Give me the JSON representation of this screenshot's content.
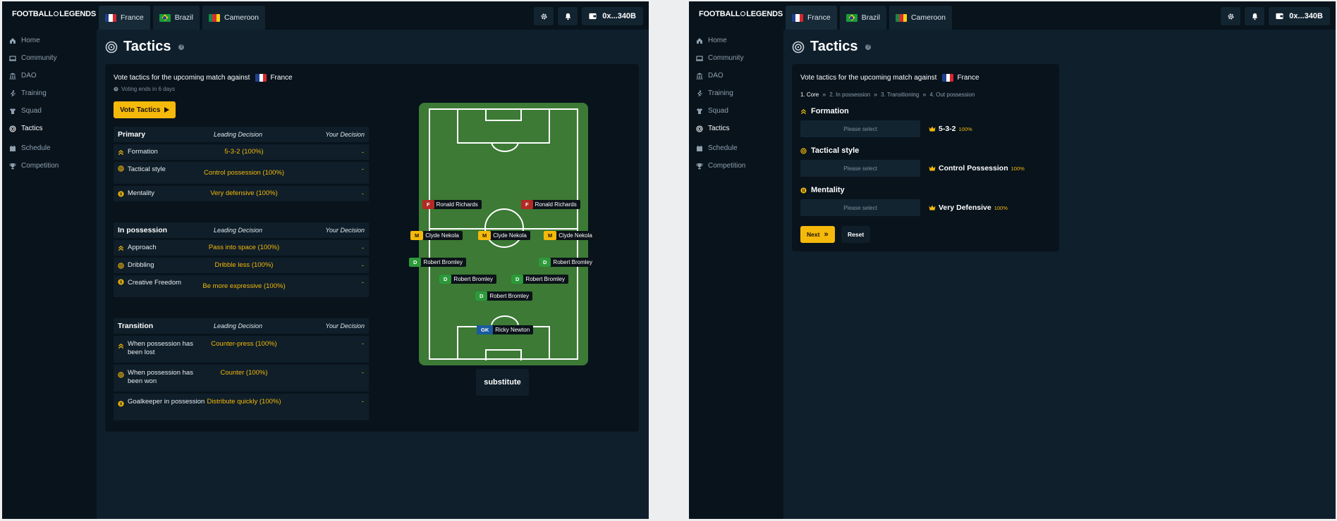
{
  "app": {
    "logo_left": "FOOTBALL",
    "logo_right": "LEGENDS",
    "wallet": "0x...340B"
  },
  "tabs": [
    {
      "label": "France",
      "flag": "france"
    },
    {
      "label": "Brazil",
      "flag": "brazil"
    },
    {
      "label": "Cameroon",
      "flag": "cameroon"
    }
  ],
  "sidebar": {
    "items": [
      {
        "label": "Home",
        "icon": "home-icon"
      },
      {
        "label": "Community",
        "icon": "monitor-icon"
      },
      {
        "label": "DAO",
        "icon": "bank-icon"
      },
      {
        "label": "Training",
        "icon": "run-icon"
      },
      {
        "label": "Squad",
        "icon": "shirt-icon"
      },
      {
        "label": "Tactics",
        "icon": "target-icon",
        "active": true
      },
      {
        "label": "Schedule",
        "icon": "calendar-icon"
      },
      {
        "label": "Competition",
        "icon": "trophy-icon"
      }
    ]
  },
  "page": {
    "title": "Tactics",
    "help": "?"
  },
  "vote": {
    "text": "Vote tactics for the upcoming match against",
    "opponent": "France",
    "ends": "Voting ends in 6 days",
    "button": "Vote Tactics"
  },
  "table_headers": {
    "leading": "Leading Decision",
    "yours": "Your Decision"
  },
  "sections": [
    {
      "title": "Primary",
      "rows": [
        {
          "label": "Formation",
          "lead": "5-3-2 (100%)",
          "yours": "-"
        },
        {
          "label": "Tactical style",
          "lead": "Control possession (100%)",
          "yours": "-"
        },
        {
          "label": "Mentality",
          "lead": "Very defensive (100%)",
          "yours": "-"
        }
      ]
    },
    {
      "title": "In possession",
      "rows": [
        {
          "label": "Approach",
          "lead": "Pass into space (100%)",
          "yours": "-"
        },
        {
          "label": "Dribbling",
          "lead": "Dribble less (100%)",
          "yours": "-"
        },
        {
          "label": "Creative Freedom",
          "lead": "Be more expressive (100%)",
          "yours": "-"
        }
      ]
    },
    {
      "title": "Transition",
      "rows": [
        {
          "label": "When possession has been lost",
          "lead": "Counter-press (100%)",
          "yours": "-"
        },
        {
          "label": "When possession has been won",
          "lead": "Counter (100%)",
          "yours": "-"
        },
        {
          "label": "Goalkeeper in possession",
          "lead": "Distribute quickly (100%)",
          "yours": "-"
        }
      ]
    }
  ],
  "players": [
    {
      "pos": "F",
      "name": "Ronald Richards"
    },
    {
      "pos": "F",
      "name": "Ronald Richards"
    },
    {
      "pos": "M",
      "name": "Clyde Nekola"
    },
    {
      "pos": "M",
      "name": "Clyde Nekola"
    },
    {
      "pos": "M",
      "name": "Clyde Nekola"
    },
    {
      "pos": "D",
      "name": "Robert Bromley"
    },
    {
      "pos": "D",
      "name": "Robert Bromley"
    },
    {
      "pos": "D",
      "name": "Robert Bromley"
    },
    {
      "pos": "D",
      "name": "Robert Bromley"
    },
    {
      "pos": "D",
      "name": "Robert Bromley"
    },
    {
      "pos": "GK",
      "name": "Ricky Newton"
    }
  ],
  "substitute": "substitute",
  "wizard": {
    "steps": [
      "1. Core",
      "2. In possession",
      "3. Transitioning",
      "4. Out possession"
    ],
    "fields": [
      {
        "title": "Formation",
        "placeholder": "Please select",
        "leading": "5-3-2",
        "pct": "100%"
      },
      {
        "title": "Tactical style",
        "placeholder": "Please select",
        "leading": "Control Possession",
        "pct": "100%"
      },
      {
        "title": "Mentality",
        "placeholder": "Please select",
        "leading": "Very Defensive",
        "pct": "100%"
      }
    ],
    "next": "Next",
    "reset": "Reset"
  },
  "colors": {
    "accent": "#f5b90b",
    "bg": "#0f1f2c",
    "panel": "#08131c"
  }
}
